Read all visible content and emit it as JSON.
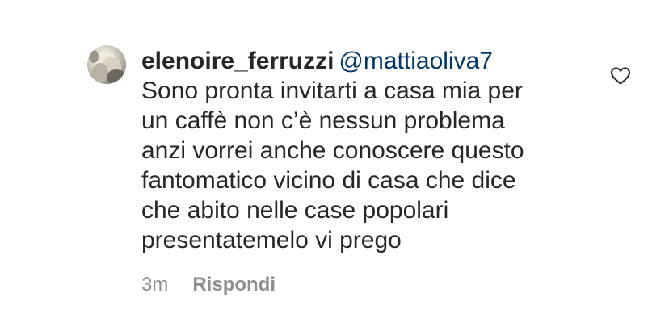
{
  "comment": {
    "username": "elenoire_ferruzzi",
    "mention": "@mattiaoliva7",
    "text_lines": [
      "Sono pronta invitarti a casa mia per",
      "un caffè non c’è nessun problema",
      "anzi vorrei anche conoscere questo",
      "fantomatico vicino di casa che dice",
      "che abito nelle case popolari",
      "presentatemelo vi prego"
    ],
    "timestamp": "3m",
    "reply_label": "Rispondi"
  },
  "icons": {
    "like": "heart-outline-icon",
    "avatar": "profile-photo"
  },
  "colors": {
    "text": "#262626",
    "mention": "#00376b",
    "meta": "#8e8e8e",
    "background": "#ffffff"
  }
}
